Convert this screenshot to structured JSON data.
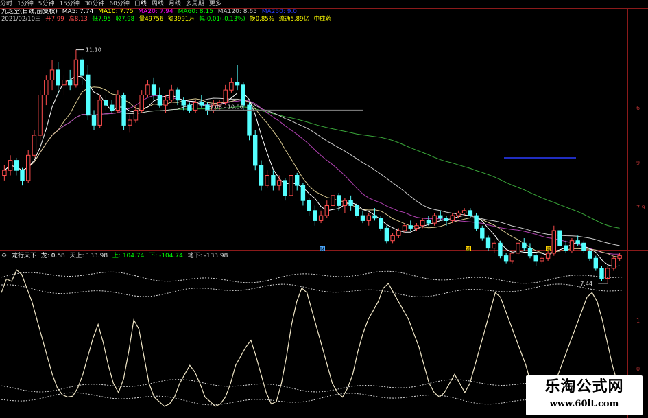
{
  "toolbar": {
    "items": [
      "分时",
      "1分钟",
      "5分钟",
      "15分钟",
      "30分钟",
      "60分钟",
      "日线",
      "周线",
      "月线",
      "多周期",
      "更多"
    ]
  },
  "info_line1": {
    "stock": "九芝堂(日线,前复权)",
    "ma5": "MA5: 7.74",
    "ma10": "MA10: 7.75",
    "ma20": "MA20: 7.94",
    "ma60": "MA60: 8.15",
    "ma120": "MA120: 8.65",
    "ma250": "MA250: 9.0",
    "colors": {
      "ma5": "#ffffff",
      "ma10": "#ffff00",
      "ma20": "#ff00ff",
      "ma60": "#00ff00",
      "ma120": "#cccccc",
      "ma250": "#2a3cff"
    }
  },
  "info_line2": {
    "date": "2021/02/10三",
    "open": "开7.99",
    "high": "高8.13",
    "low": "低7.95",
    "close": "收7.98",
    "volume": "量49756",
    "amount": "额3991万",
    "change": "幅-0.01(-0.13%)",
    "turnover": "换0.85%",
    "float_cap": "流通5.89亿",
    "sector": "中成药"
  },
  "indicator": {
    "name": "龙行天下",
    "long": "龙: 0.58",
    "sky_up": "天上: 133.98",
    "upper": "上: 104.74",
    "lower": "下: -104.74",
    "ground": "地下: -133.98"
  },
  "price_annotations": {
    "high_label": "11.10",
    "low_label": "7.44",
    "range_label": "9.08 - 10.06"
  },
  "right_axis": [
    "6",
    "9",
    "7.9",
    "1",
    "0"
  ],
  "markers": [
    {
      "label": "财",
      "color": "#4aa8ff"
    },
    {
      "label": "减",
      "color": "#ffd400"
    },
    {
      "label": "增",
      "color": "#ffd400"
    }
  ],
  "watermark": {
    "line1": "乐淘公式网",
    "line2": "www.60lt.com"
  },
  "colors": {
    "up": "#ff4d4d",
    "down": "#54ffff",
    "grid": "#8b1a1a",
    "dotted": "#d8d8d8",
    "line": "#f2e8c8"
  },
  "chart_data": [
    {
      "type": "candlestick",
      "title": "九芝堂(日线,前复权)",
      "ylim": [
        7.2,
        11.6
      ],
      "candles": [
        [
          8.6,
          8.8,
          8.5,
          8.7
        ],
        [
          8.7,
          9.0,
          8.6,
          8.9
        ],
        [
          8.9,
          8.95,
          8.6,
          8.7
        ],
        [
          8.7,
          8.75,
          8.4,
          8.5
        ],
        [
          8.5,
          9.1,
          8.45,
          9.0
        ],
        [
          9.0,
          9.5,
          8.95,
          9.4
        ],
        [
          9.4,
          10.3,
          9.3,
          10.2
        ],
        [
          10.2,
          10.6,
          10.0,
          10.5
        ],
        [
          10.5,
          10.9,
          10.3,
          10.7
        ],
        [
          10.7,
          10.85,
          10.2,
          10.4
        ],
        [
          10.4,
          10.6,
          10.2,
          10.5
        ],
        [
          10.5,
          10.7,
          10.3,
          10.4
        ],
        [
          10.4,
          11.1,
          10.35,
          10.9
        ],
        [
          10.9,
          10.95,
          10.4,
          10.6
        ],
        [
          10.6,
          10.8,
          9.7,
          9.8
        ],
        [
          9.8,
          9.9,
          9.5,
          9.6
        ],
        [
          9.6,
          10.2,
          9.55,
          10.1
        ],
        [
          10.1,
          10.2,
          9.9,
          10.0
        ],
        [
          10.0,
          10.1,
          9.85,
          9.9
        ],
        [
          9.9,
          10.3,
          9.85,
          10.2
        ],
        [
          10.2,
          10.25,
          9.5,
          9.6
        ],
        [
          9.6,
          9.8,
          9.45,
          9.7
        ],
        [
          9.7,
          10.0,
          9.65,
          9.9
        ],
        [
          9.9,
          10.3,
          9.85,
          10.2
        ],
        [
          10.2,
          10.5,
          10.15,
          10.4
        ],
        [
          10.4,
          10.55,
          10.1,
          10.2
        ],
        [
          10.2,
          10.35,
          9.95,
          10.0
        ],
        [
          10.0,
          10.2,
          9.85,
          10.1
        ],
        [
          10.1,
          10.4,
          10.05,
          10.3
        ],
        [
          10.3,
          10.35,
          10.0,
          10.1
        ],
        [
          10.1,
          10.15,
          9.9,
          10.0
        ],
        [
          10.0,
          10.05,
          9.85,
          9.9
        ],
        [
          9.9,
          10.1,
          9.85,
          10.05
        ],
        [
          10.05,
          10.2,
          9.95,
          10.0
        ],
        [
          10.0,
          10.05,
          9.8,
          9.9
        ],
        [
          9.9,
          10.1,
          9.85,
          10.0
        ],
        [
          10.0,
          10.1,
          9.9,
          10.05
        ],
        [
          10.05,
          10.4,
          10.0,
          10.3
        ],
        [
          10.3,
          10.55,
          10.25,
          10.45
        ],
        [
          10.45,
          10.8,
          10.3,
          10.4
        ],
        [
          10.4,
          10.45,
          9.9,
          10.0
        ],
        [
          10.0,
          10.05,
          9.3,
          9.4
        ],
        [
          9.4,
          9.5,
          8.7,
          8.8
        ],
        [
          8.8,
          8.9,
          8.3,
          8.4
        ],
        [
          8.4,
          8.7,
          8.35,
          8.6
        ],
        [
          8.6,
          8.7,
          8.3,
          8.4
        ],
        [
          8.4,
          8.6,
          8.3,
          8.5
        ],
        [
          8.5,
          8.55,
          8.1,
          8.2
        ],
        [
          8.2,
          8.7,
          8.15,
          8.6
        ],
        [
          8.6,
          8.65,
          8.3,
          8.4
        ],
        [
          8.4,
          8.45,
          8.0,
          8.1
        ],
        [
          8.1,
          8.15,
          7.8,
          7.9
        ],
        [
          7.9,
          8.0,
          7.6,
          7.7
        ],
        [
          7.7,
          7.9,
          7.65,
          7.8
        ],
        [
          7.8,
          8.1,
          7.75,
          8.0
        ],
        [
          8.0,
          8.3,
          7.95,
          8.2
        ],
        [
          8.2,
          8.25,
          7.9,
          8.0
        ],
        [
          8.0,
          8.15,
          7.85,
          8.1
        ],
        [
          8.1,
          8.2,
          7.9,
          8.0
        ],
        [
          8.0,
          8.05,
          7.75,
          7.8
        ],
        [
          7.8,
          7.9,
          7.65,
          7.7
        ],
        [
          7.7,
          7.85,
          7.6,
          7.8
        ],
        [
          7.8,
          7.95,
          7.7,
          7.75
        ],
        [
          7.75,
          7.8,
          7.5,
          7.55
        ],
        [
          7.55,
          7.6,
          7.25,
          7.3
        ],
        [
          7.3,
          7.45,
          7.25,
          7.4
        ],
        [
          7.4,
          7.55,
          7.35,
          7.5
        ],
        [
          7.5,
          7.65,
          7.45,
          7.6
        ],
        [
          7.6,
          7.7,
          7.5,
          7.55
        ],
        [
          7.55,
          7.65,
          7.5,
          7.6
        ],
        [
          7.6,
          7.75,
          7.55,
          7.7
        ],
        [
          7.7,
          7.8,
          7.6,
          7.65
        ],
        [
          7.65,
          7.85,
          7.6,
          7.8
        ],
        [
          7.8,
          7.9,
          7.7,
          7.75
        ],
        [
          7.75,
          7.8,
          7.6,
          7.7
        ],
        [
          7.7,
          7.85,
          7.65,
          7.8
        ],
        [
          7.8,
          7.9,
          7.75,
          7.85
        ],
        [
          7.85,
          7.95,
          7.8,
          7.9
        ],
        [
          7.9,
          7.95,
          7.75,
          7.8
        ],
        [
          7.8,
          7.85,
          7.5,
          7.55
        ],
        [
          7.55,
          7.6,
          7.3,
          7.35
        ],
        [
          7.35,
          7.4,
          7.1,
          7.15
        ],
        [
          7.15,
          7.3,
          7.05,
          7.25
        ],
        [
          7.25,
          7.3,
          6.95,
          7.0
        ],
        [
          7.0,
          7.05,
          6.85,
          6.9
        ],
        [
          6.9,
          7.1,
          6.85,
          7.05
        ],
        [
          7.05,
          7.3,
          7.0,
          7.25
        ],
        [
          7.25,
          7.35,
          7.1,
          7.15
        ],
        [
          7.15,
          7.25,
          6.95,
          7.0
        ],
        [
          7.0,
          7.05,
          6.8,
          6.9
        ],
        [
          6.9,
          7.0,
          6.85,
          6.95
        ],
        [
          6.95,
          7.1,
          6.9,
          7.05
        ],
        [
          7.05,
          7.6,
          7.0,
          7.5
        ],
        [
          7.5,
          7.55,
          7.15,
          7.2
        ],
        [
          7.2,
          7.3,
          7.05,
          7.1
        ],
        [
          7.1,
          7.35,
          7.05,
          7.3
        ],
        [
          7.3,
          7.4,
          7.2,
          7.25
        ],
        [
          7.25,
          7.3,
          7.05,
          7.1
        ],
        [
          7.1,
          7.15,
          6.9,
          6.95
        ],
        [
          6.95,
          7.0,
          6.7,
          6.75
        ],
        [
          6.75,
          6.8,
          6.5,
          6.55
        ],
        [
          6.55,
          6.8,
          6.45,
          6.75
        ],
        [
          6.75,
          7.0,
          6.7,
          6.95
        ],
        [
          6.95,
          7.05,
          6.9,
          7.0
        ]
      ]
    },
    {
      "type": "line",
      "title": "龙行天下",
      "ylim": [
        -170,
        170
      ],
      "series": [
        {
          "name": "龙",
          "values": [
            100,
            130,
            125,
            150,
            140,
            110,
            80,
            40,
            0,
            -40,
            -80,
            -110,
            -125,
            -130,
            -128,
            -110,
            -80,
            -40,
            0,
            30,
            -10,
            -60,
            -100,
            -120,
            -90,
            -30,
            40,
            20,
            -40,
            -100,
            -130,
            -140,
            -150,
            -145,
            -130,
            -100,
            -80,
            -60,
            -75,
            -100,
            -130,
            -140,
            -150,
            -145,
            -130,
            -100,
            -60,
            -40,
            -20,
            -5,
            -40,
            -80,
            -120,
            -145,
            -140,
            -100,
            -40,
            30,
            80,
            110,
            100,
            60,
            20,
            -20,
            -60,
            -100,
            -120,
            -130,
            -110,
            -80,
            -30,
            10,
            40,
            60,
            80,
            110,
            120,
            100,
            80,
            60,
            40,
            10,
            -20,
            -60,
            -100,
            -120,
            -130,
            -120,
            -100,
            -80,
            -100,
            -120,
            -100,
            -60,
            -20,
            20,
            60,
            100,
            90,
            60,
            30,
            0,
            -30,
            -60,
            -100,
            -120,
            -130,
            -110,
            -100,
            -90,
            -60,
            -30,
            0,
            30,
            60,
            90,
            100,
            80,
            40,
            -10,
            -60,
            -100,
            -130
          ]
        },
        {
          "name": "天上",
          "values": [
            133.98
          ]
        },
        {
          "name": "上",
          "values": [
            104.74
          ]
        },
        {
          "name": "下",
          "values": [
            -104.74
          ]
        },
        {
          "name": "地下",
          "values": [
            -133.98
          ]
        }
      ]
    }
  ]
}
